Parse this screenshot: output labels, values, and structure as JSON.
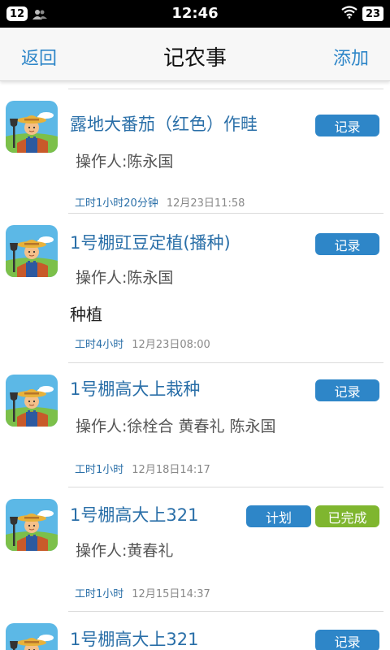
{
  "status_bar": {
    "notification_count": "12",
    "time": "12:46",
    "battery": "23"
  },
  "nav": {
    "back_label": "返回",
    "title": "记农事",
    "add_label": "添加"
  },
  "colors": {
    "accent_blue": "#2e86c8",
    "done_green": "#7fb62f"
  },
  "records": [
    {
      "title": "露地大番茄（红色）作畦",
      "badges": [
        {
          "label": "记录",
          "color": "blue"
        }
      ],
      "operator": "操作人:陈永国",
      "note": "",
      "hours": "工时1小时20分钟",
      "datetime": "12月23日11:58",
      "avatar": "farmer-icon"
    },
    {
      "title": "1号棚豇豆定植(播种)",
      "badges": [
        {
          "label": "记录",
          "color": "blue"
        }
      ],
      "operator": "操作人:陈永国",
      "note": "种植",
      "hours": "工时4小时",
      "datetime": "12月23日08:00",
      "avatar": "farmer-icon"
    },
    {
      "title": "1号棚高大上栽种",
      "badges": [
        {
          "label": "记录",
          "color": "blue"
        }
      ],
      "operator": "操作人:徐栓合 黄春礼 陈永国",
      "note": "",
      "hours": "工时1小时",
      "datetime": "12月18日14:17",
      "avatar": "farmer-icon"
    },
    {
      "title": "1号棚高大上321",
      "badges": [
        {
          "label": "计划",
          "color": "blue"
        },
        {
          "label": "已完成",
          "color": "green"
        }
      ],
      "operator": "操作人:黄春礼",
      "note": "",
      "hours": "工时1小时",
      "datetime": "12月15日14:37",
      "avatar": "farmer-icon"
    },
    {
      "title": "1号棚高大上321",
      "badges": [
        {
          "label": "记录",
          "color": "blue"
        }
      ],
      "operator": "",
      "note": "",
      "hours": "",
      "datetime": "",
      "avatar": "farmer-icon"
    }
  ]
}
